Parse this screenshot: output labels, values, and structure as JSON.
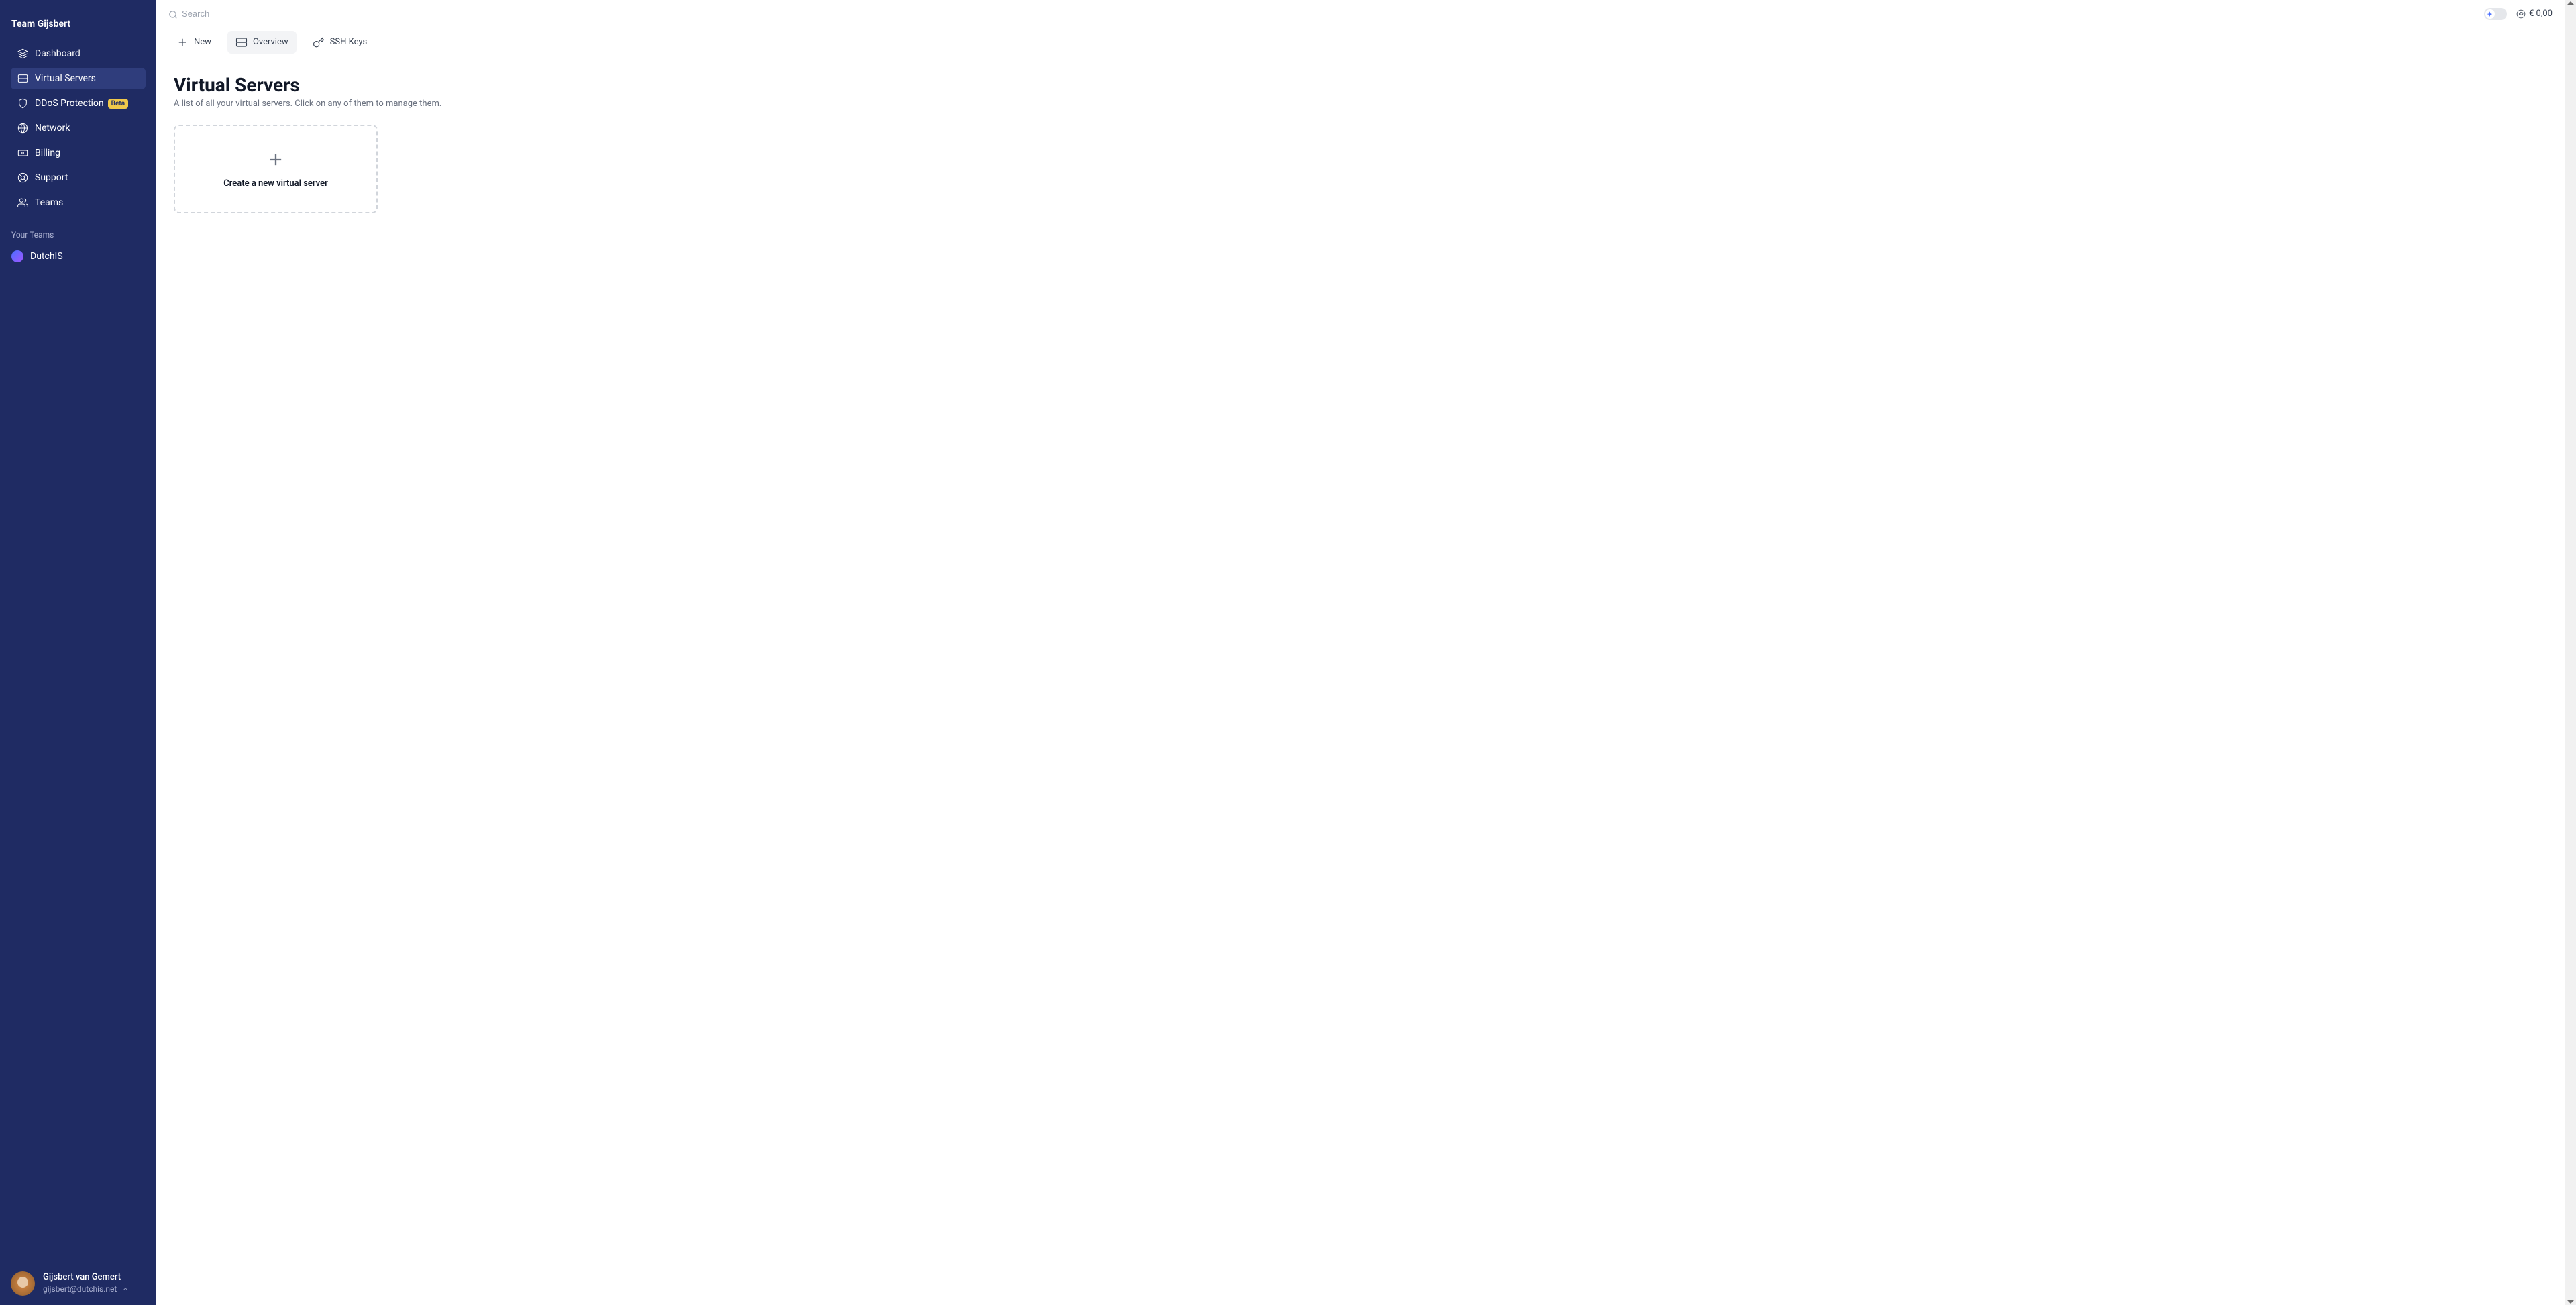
{
  "sidebar": {
    "team_name": "Team Gijsbert",
    "nav": [
      {
        "label": "Dashboard",
        "icon": "dashboard"
      },
      {
        "label": "Virtual Servers",
        "icon": "server",
        "active": true
      },
      {
        "label": "DDoS Protection",
        "icon": "shield",
        "badge": "Beta"
      },
      {
        "label": "Network",
        "icon": "globe"
      },
      {
        "label": "Billing",
        "icon": "banknote"
      },
      {
        "label": "Support",
        "icon": "lifebuoy"
      },
      {
        "label": "Teams",
        "icon": "users"
      }
    ],
    "your_teams_label": "Your Teams",
    "teams": [
      {
        "label": "DutchIS"
      }
    ],
    "user": {
      "name": "Gijsbert van Gemert",
      "email": "gijsbert@dutchis.net"
    }
  },
  "topbar": {
    "search_placeholder": "Search",
    "balance": "€ 0,00"
  },
  "tabs": [
    {
      "label": "New",
      "icon": "plus"
    },
    {
      "label": "Overview",
      "icon": "server",
      "active": true
    },
    {
      "label": "SSH Keys",
      "icon": "key"
    }
  ],
  "page": {
    "title": "Virtual Servers",
    "subtitle": "A list of all your virtual servers. Click on any of them to manage them.",
    "create_label": "Create a new virtual server"
  }
}
